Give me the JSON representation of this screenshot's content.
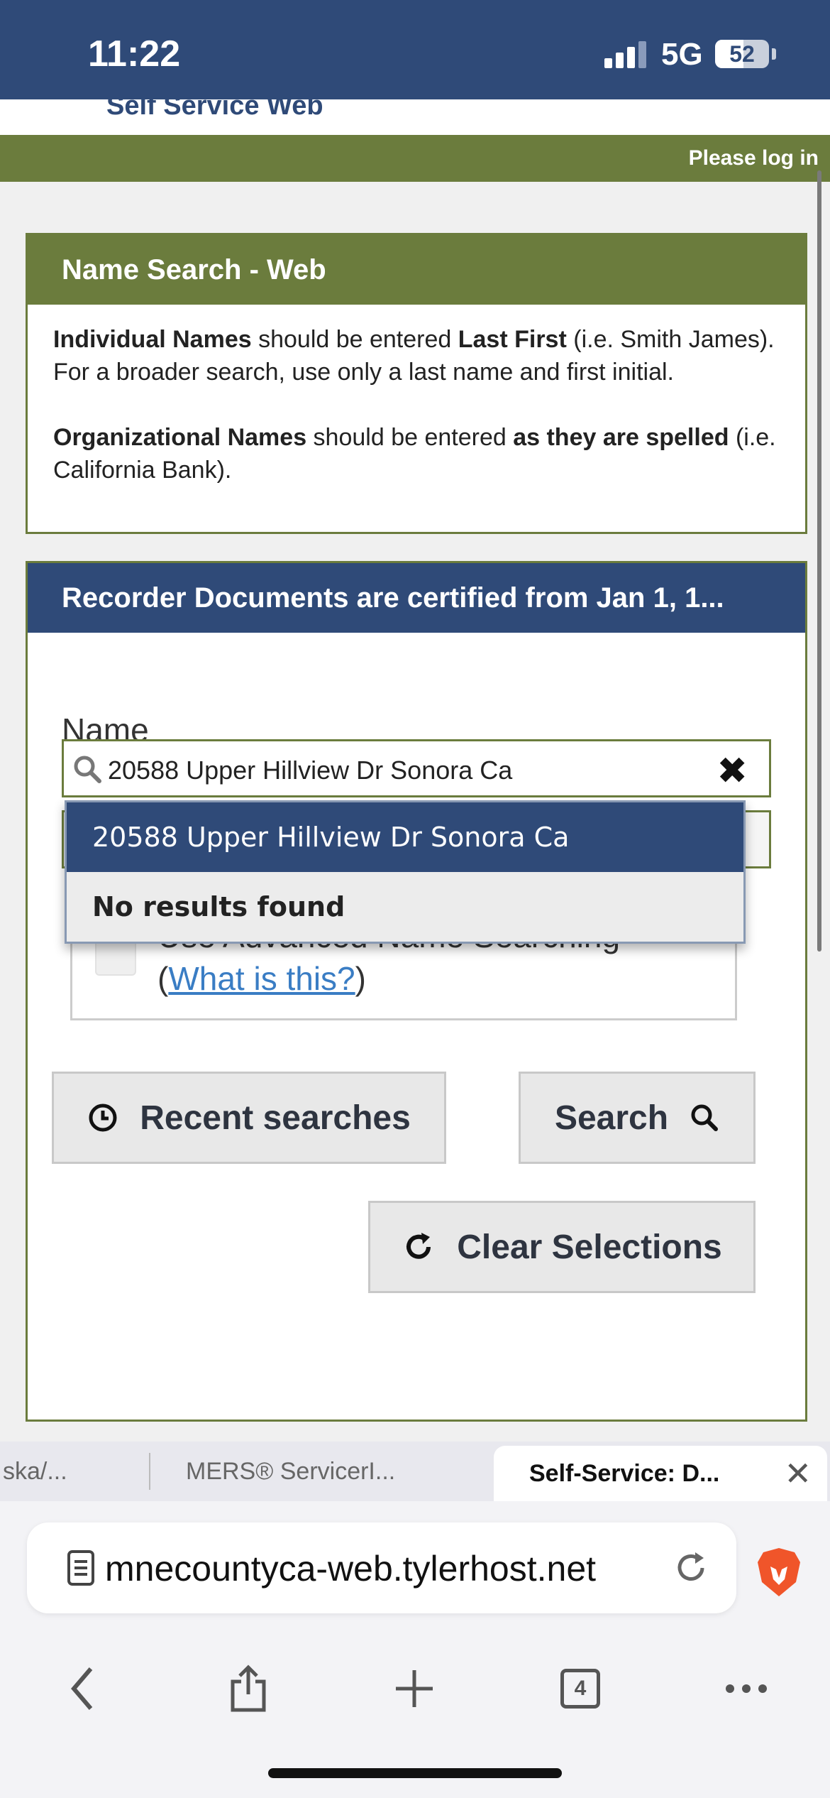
{
  "status_bar": {
    "time": "11:22",
    "network": "5G",
    "battery": "52"
  },
  "site": {
    "brand_partial": "Self Service Web",
    "login_prompt": "Please log in"
  },
  "info_panel": {
    "title": "Name Search - Web",
    "p1_a": "Individual Names",
    "p1_b": " should be entered ",
    "p1_c": "Last First",
    "p1_d": " (i.e. Smith James). For a broader search, use only a last name and first initial.",
    "p2_a": "Organizational Names",
    "p2_b": " should be entered ",
    "p2_c": "as they are spelled",
    "p2_d": " (i.e. California Bank)."
  },
  "search_panel": {
    "title": "Recorder Documents are certified from Jan 1, 1...",
    "name_label": "Name",
    "name_value": "20588 Upper Hillview Dr Sonora Ca",
    "dropdown": {
      "option": "20588 Upper Hillview Dr Sonora Ca",
      "no_results": "No results found"
    },
    "advanced_label": "Use Advanced Name Searching",
    "advanced_open_paren": "(",
    "advanced_link": "What is this?",
    "advanced_close_paren": ")",
    "recent_label": "Recent searches",
    "search_label": "Search",
    "clear_label": "Clear Selections"
  },
  "browser": {
    "tabs": [
      {
        "label": "ska/..."
      },
      {
        "label": "MERS® ServicerI..."
      },
      {
        "label": "Self-Service: D..."
      }
    ],
    "url": "mnecountyca-web.tylerhost.net",
    "tab_count": "4"
  }
}
